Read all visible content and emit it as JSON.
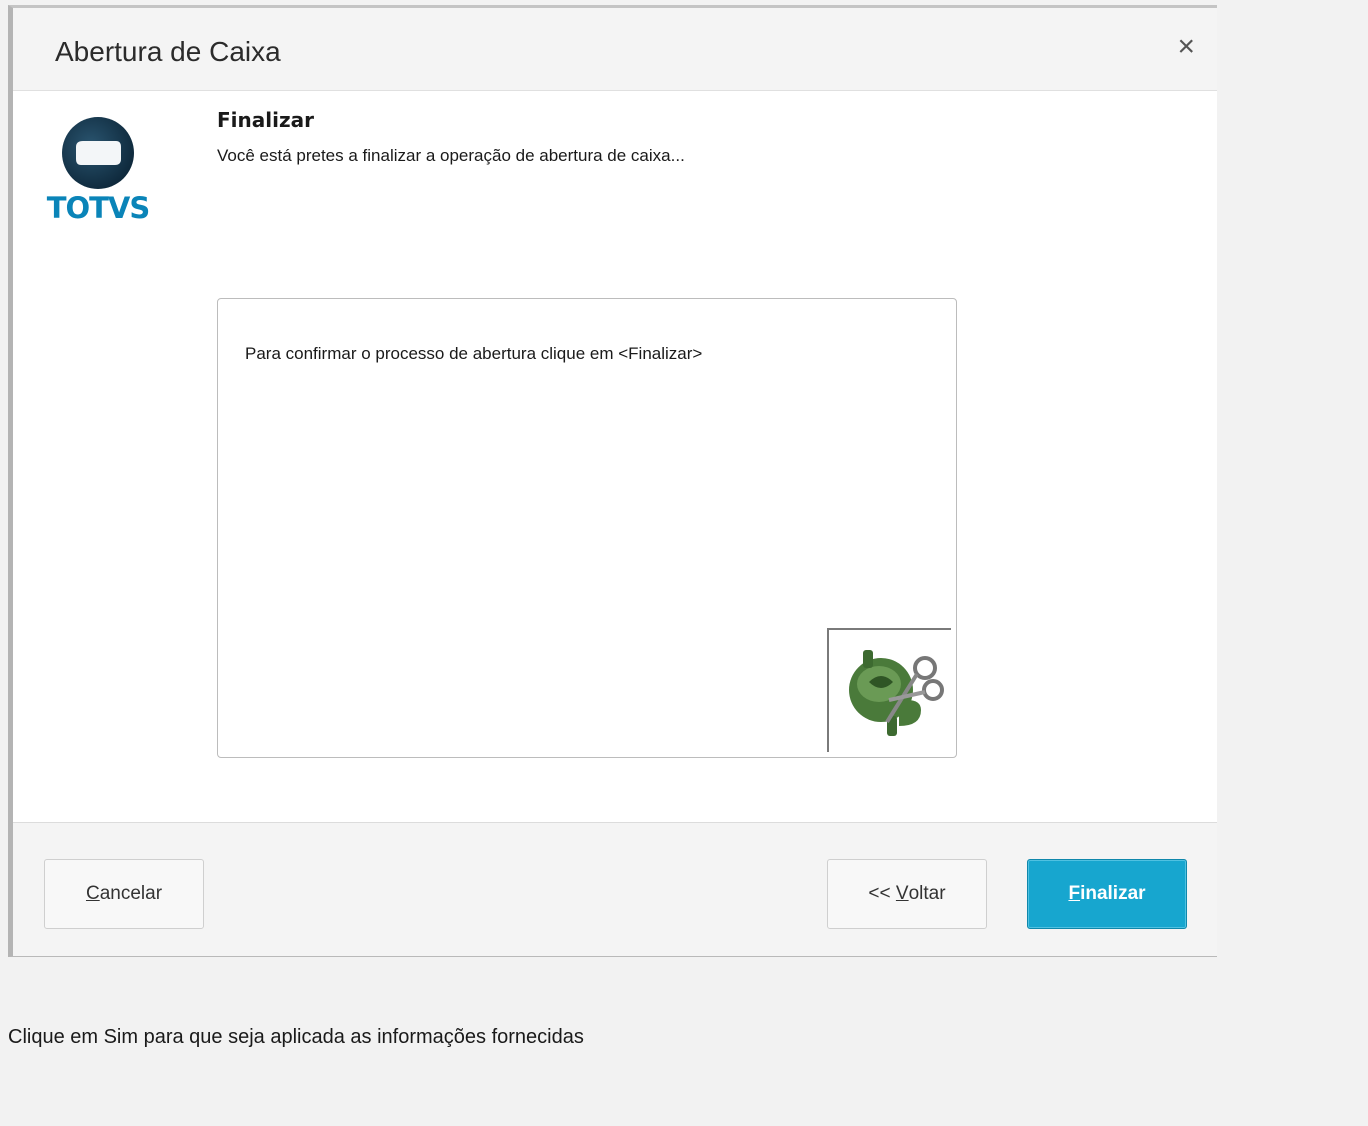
{
  "dialog": {
    "title": "Abertura de Caixa",
    "close_symbol": "×",
    "logo_text": "TOTVS",
    "step_title": "Finalizar",
    "step_description": "Você está pretes a finalizar a operação de abertura de caixa...",
    "content_text": "Para confirmar o processo de abertura clique em <Finalizar>",
    "icon": "money-scissors-icon"
  },
  "footer": {
    "cancel": {
      "mnemonic": "C",
      "rest": "ancelar"
    },
    "back": {
      "prefix": "<< ",
      "mnemonic": "V",
      "rest": "oltar"
    },
    "finish": {
      "mnemonic": "F",
      "rest": "inalizar"
    }
  },
  "caption": "Clique em Sim para que seja aplicada as informações fornecidas",
  "colors": {
    "accent": "#17a6cf",
    "brand_blue": "#0a84b8",
    "icon_green": "#4a7a3a"
  }
}
